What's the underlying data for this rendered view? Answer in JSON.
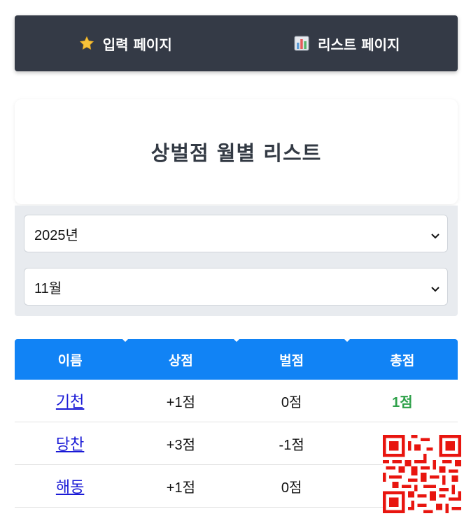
{
  "nav": {
    "items": [
      {
        "label": "입력 페이지",
        "icon": "star-icon"
      },
      {
        "label": "리스트 페이지",
        "icon": "bar-chart-icon"
      }
    ],
    "background": "#343a46"
  },
  "page_title": "상벌점 월별 리스트",
  "filters": {
    "year": "2025년",
    "month": "11월"
  },
  "table": {
    "headers": [
      "이름",
      "상점",
      "벌점",
      "총점"
    ],
    "rows": [
      {
        "name": "기천",
        "merit": "+1점",
        "demerit": "0점",
        "total": "1점"
      },
      {
        "name": "당찬",
        "merit": "+3점",
        "demerit": "-1점",
        "total": ""
      },
      {
        "name": "해동",
        "merit": "+1점",
        "demerit": "0점",
        "total": ""
      }
    ],
    "header_color": "#1183f5",
    "total_color": "#2ea14a"
  }
}
